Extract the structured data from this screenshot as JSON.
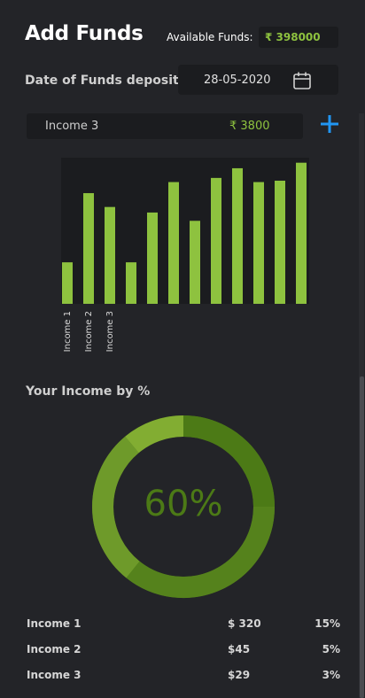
{
  "header": {
    "title": "Add Funds",
    "available_label": "Available Funds:",
    "available_value": "₹ 398000"
  },
  "deposit": {
    "label": "Date of Funds deposit",
    "date": "28-05-2020",
    "calendar_icon": "calendar-icon"
  },
  "income_entry": {
    "name": "Income 3",
    "amount": "₹ 3800",
    "add_icon": "plus-icon"
  },
  "colors": {
    "accent_green": "#8ec23f",
    "donut_dark": "#4c7a16",
    "donut_mid": "#6e9a2a",
    "donut_light": "#82ad32",
    "add_blue": "#2196f3",
    "background": "#232428"
  },
  "chart_data": {
    "type": "bar",
    "categories": [
      "Income 1",
      "Income 2",
      "Income 3",
      "",
      "",
      "",
      "",
      "",
      "",
      "",
      "",
      ""
    ],
    "values": [
      30,
      80,
      70,
      30,
      66,
      88,
      60,
      91,
      98,
      88,
      89,
      102
    ],
    "ylim": [
      0,
      105
    ],
    "title": "",
    "xlabel": "",
    "ylabel": "",
    "grid": false,
    "legend": "none"
  },
  "income_by_percent": {
    "title": "Your Income by %",
    "center_value": "60%",
    "segments": [
      {
        "label": "Income 1",
        "value": 15
      },
      {
        "label": "Income 2",
        "value": 5
      },
      {
        "label": "Income 3",
        "value": 3
      }
    ]
  },
  "income_table": [
    {
      "name": "Income 1",
      "amount": "$ 320",
      "percent": "15%"
    },
    {
      "name": "Income 2",
      "amount": "$45",
      "percent": "5%"
    },
    {
      "name": "Income 3",
      "amount": "$29",
      "percent": "3%"
    }
  ]
}
